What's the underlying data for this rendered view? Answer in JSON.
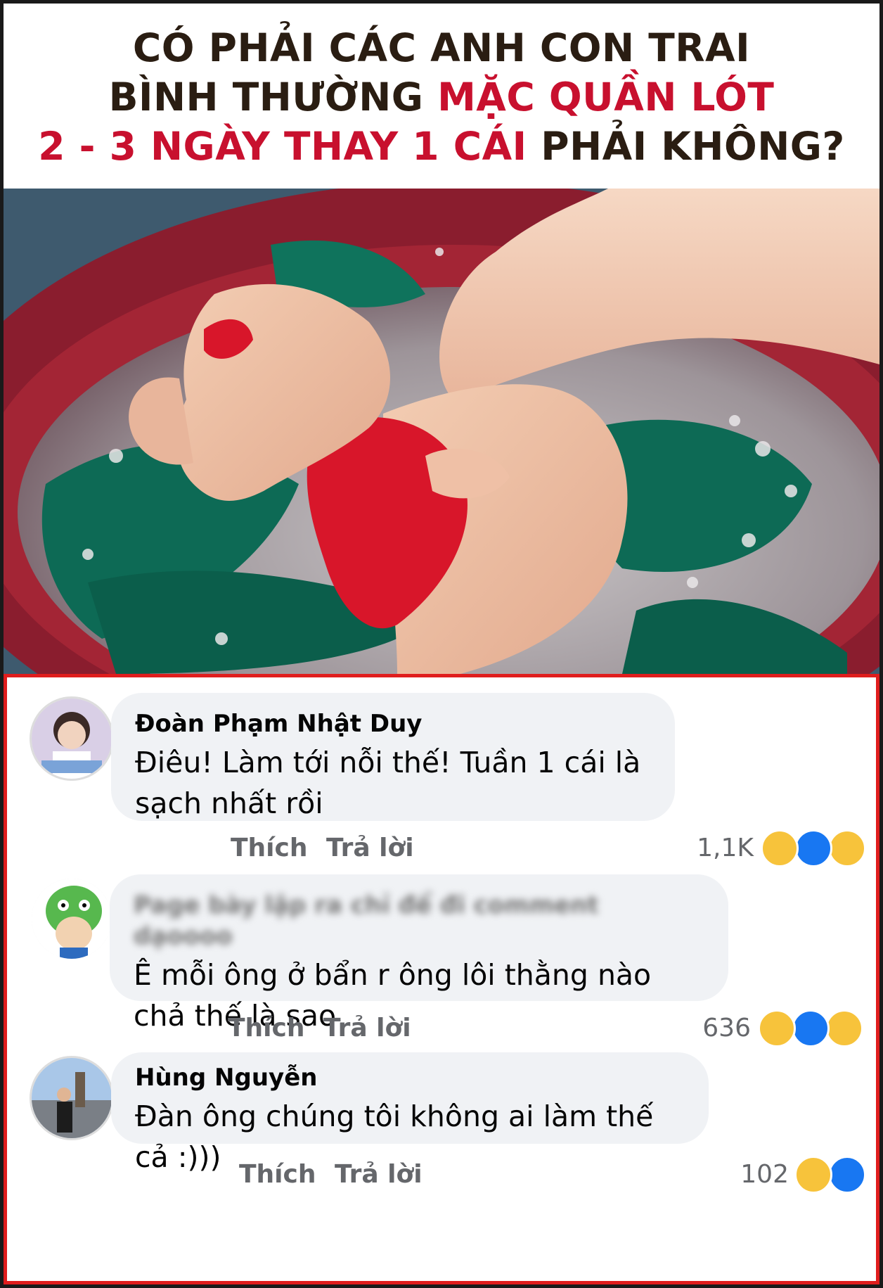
{
  "headline": {
    "line1": "CÓ PHẢI CÁC ANH CON TRAI",
    "line2_dark": "BÌNH THƯỜNG ",
    "line2_red": "MẶC QUẦN LÓT",
    "line3_red": "2 - 3 NGÀY THAY 1 CÁI",
    "line3_dark": " PHẢI KHÔNG?",
    "dark_color": "#2a1d12",
    "red_color": "#c8102e"
  },
  "photo": {
    "description_icon": "hands-washing-laundry-image"
  },
  "comments": [
    {
      "author": "Đoàn Phạm Nhật Duy",
      "text": "Điêu! Làm tới nỗi thế! Tuần 1 cái là sạch nhất rồi",
      "like_label": "Thích",
      "reply_label": "Trả lời",
      "reaction_count": "1,1K",
      "reactions": [
        "haha",
        "like",
        "sad"
      ]
    },
    {
      "author": "Page bày lập ra chỉ để đi comment dạoooo",
      "author_blurred": true,
      "text": "Ê mỗi ông ở bẩn r ông lôi thằng nào chả thế là sao",
      "like_label": "Thích",
      "reply_label": "Trả lời",
      "reaction_count": "636",
      "reactions": [
        "haha",
        "like",
        "sad"
      ]
    },
    {
      "author": "Hùng Nguyễn",
      "text": "Đàn ông chúng tôi không ai làm thế cả :)))",
      "like_label": "Thích",
      "reply_label": "Trả lời",
      "reaction_count": "102",
      "reactions": [
        "haha",
        "like"
      ]
    }
  ],
  "colors": {
    "border_red": "#e01d1d",
    "bubble_bg": "#f0f2f5",
    "muted_text": "#65676b",
    "like_blue": "#1877f2",
    "haha_yellow": "#f7c33b"
  }
}
